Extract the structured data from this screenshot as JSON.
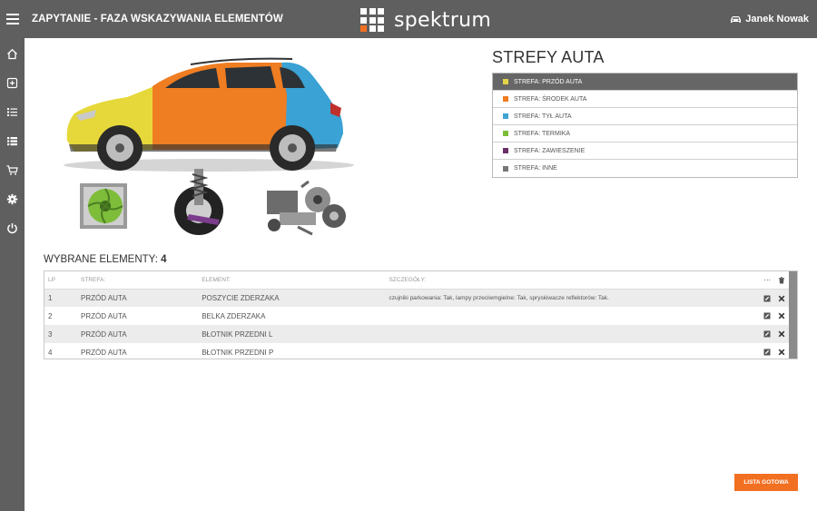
{
  "header": {
    "title": "ZAPYTANIE - FAZA WSKAZYWANIA ELEMENTÓW",
    "brand": "spektrum",
    "user": "Janek Nowak"
  },
  "sidebar": {
    "items": [
      "home-icon",
      "add-icon",
      "list-numbered-icon",
      "list-icon",
      "cart-icon",
      "gear-icon",
      "power-icon"
    ]
  },
  "zones": {
    "title": "STREFY AUTA",
    "items": [
      {
        "label": "STREFA: PRZÓD AUTA",
        "color": "#e4d44a",
        "active": true
      },
      {
        "label": "STREFA: ŚRODEK AUTA",
        "color": "#ef7d22",
        "active": false
      },
      {
        "label": "STREFA: TYŁ AUTA",
        "color": "#3fa4d3",
        "active": false
      },
      {
        "label": "STREFA: TERMIKA",
        "color": "#7dbd3a",
        "active": false
      },
      {
        "label": "STREFA: ZAWIESZENIE",
        "color": "#6b2f6a",
        "active": false
      },
      {
        "label": "STREFA: INNE",
        "color": "#777777",
        "active": false
      }
    ]
  },
  "selected": {
    "label": "WYBRANE ELEMENTY:",
    "count": "4",
    "columns": {
      "lp": "LP",
      "zone": "STREFA:",
      "element": "ELEMENT:",
      "details": "SZCZEGÓŁY:",
      "more": "···"
    },
    "rows": [
      {
        "lp": "1",
        "zone": "PRZÓD AUTA",
        "element": "POSZYCIE ZDERZAKA",
        "details": "czujniki parkowania: Tak, lampy przeciwmgielne: Tak, spryskiwacze reflektorów: Tak."
      },
      {
        "lp": "2",
        "zone": "PRZÓD AUTA",
        "element": "BELKA ZDERZAKA",
        "details": ""
      },
      {
        "lp": "3",
        "zone": "PRZÓD AUTA",
        "element": "BŁOTNIK PRZEDNI L",
        "details": ""
      },
      {
        "lp": "4",
        "zone": "PRZÓD AUTA",
        "element": "BŁOTNIK PRZEDNI P",
        "details": ""
      }
    ]
  },
  "ready_button": "LISTA GOTOWA",
  "colors": {
    "bar": "#5f5f5f",
    "accent": "#f27022"
  }
}
